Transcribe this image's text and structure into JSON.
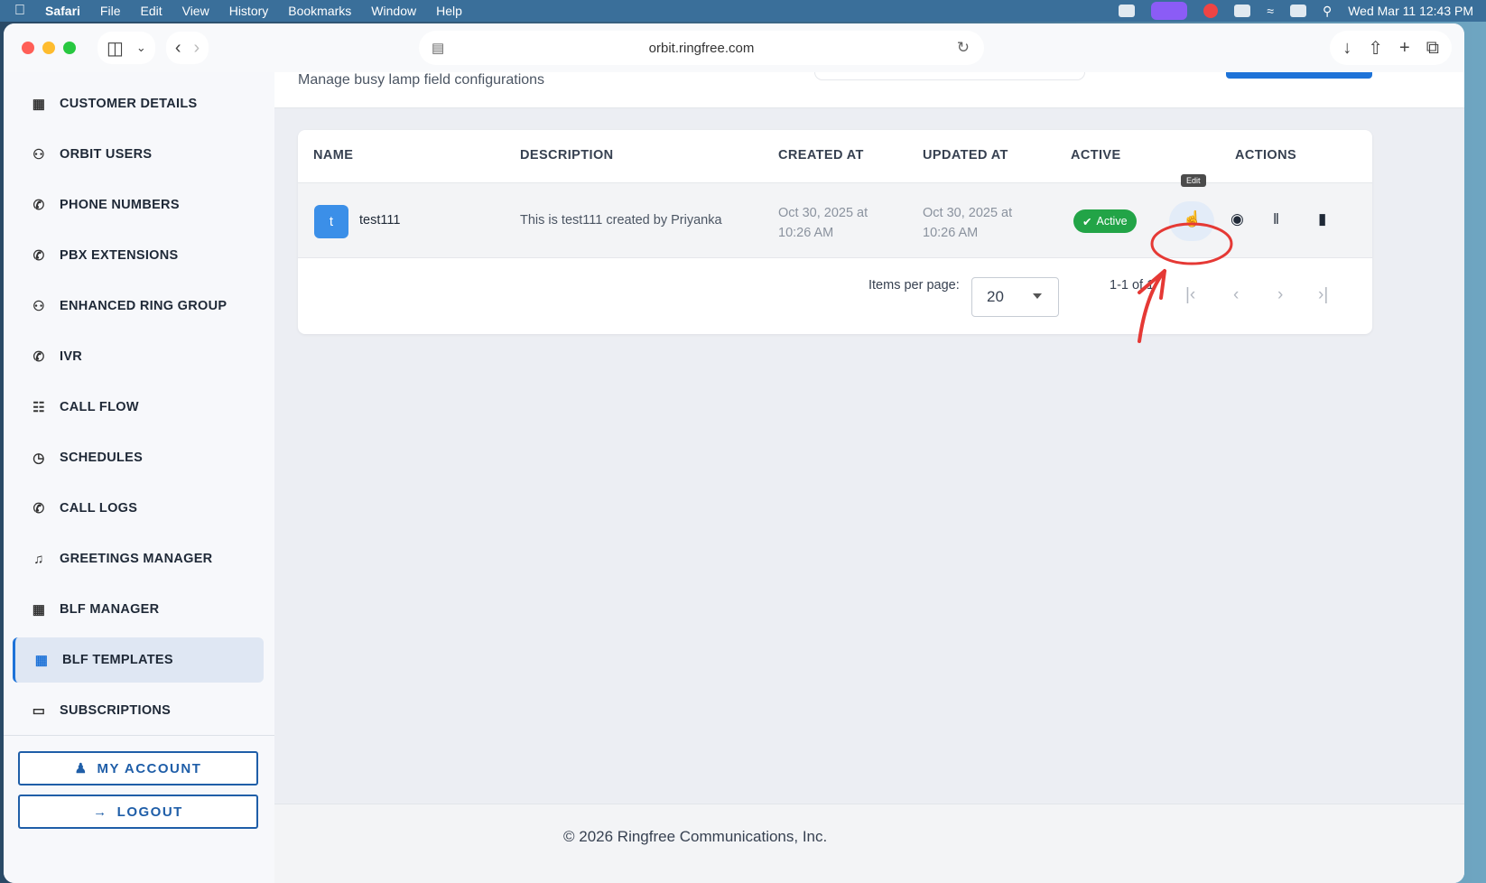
{
  "menubar": {
    "app": "Safari",
    "menus": [
      "File",
      "Edit",
      "View",
      "History",
      "Bookmarks",
      "Window",
      "Help"
    ],
    "clock": "Wed Mar 11  12:43 PM"
  },
  "browser": {
    "url": "orbit.ringfree.com"
  },
  "sidebar": {
    "items": [
      {
        "label": "CUSTOMER DETAILS",
        "icon": "building-icon"
      },
      {
        "label": "ORBIT USERS",
        "icon": "users-icon"
      },
      {
        "label": "PHONE NUMBERS",
        "icon": "phone-icon"
      },
      {
        "label": "PBX EXTENSIONS",
        "icon": "phone-forward-icon"
      },
      {
        "label": "ENHANCED RING GROUP",
        "icon": "group-icon"
      },
      {
        "label": "IVR",
        "icon": "phone-icon"
      },
      {
        "label": "CALL FLOW",
        "icon": "sitemap-icon"
      },
      {
        "label": "SCHEDULES",
        "icon": "calendar-clock-icon"
      },
      {
        "label": "CALL LOGS",
        "icon": "phone-log-icon"
      },
      {
        "label": "GREETINGS MANAGER",
        "icon": "greeting-icon"
      },
      {
        "label": "BLF MANAGER",
        "icon": "grid-icon"
      },
      {
        "label": "BLF TEMPLATES",
        "icon": "dashboard-icon",
        "active": true
      },
      {
        "label": "SUBSCRIPTIONS",
        "icon": "card-icon"
      }
    ],
    "my_account": "MY ACCOUNT",
    "logout": "LOGOUT"
  },
  "page": {
    "subtitle": "Manage busy lamp field configurations"
  },
  "table": {
    "headers": [
      "NAME",
      "DESCRIPTION",
      "CREATED AT",
      "UPDATED AT",
      "ACTIVE",
      "ACTIONS"
    ],
    "rows": [
      {
        "avatar": "t",
        "name": "test111",
        "description": "This is test111 created by Priyanka",
        "created_line1": "Oct 30, 2025 at",
        "created_line2": "10:26 AM",
        "updated_line1": "Oct 30, 2025 at",
        "updated_line2": "10:26 AM",
        "status": "Active"
      }
    ],
    "tooltip": "Edit"
  },
  "pagination": {
    "items_per_page_label": "Items per page:",
    "items_per_page": "20",
    "range": "1-1 of 1"
  },
  "footer": {
    "text": "© 2026 Ringfree Communications, Inc."
  },
  "colors": {
    "accent": "#1e73d8",
    "active_badge": "#22a447",
    "annotation": "#e53935"
  }
}
